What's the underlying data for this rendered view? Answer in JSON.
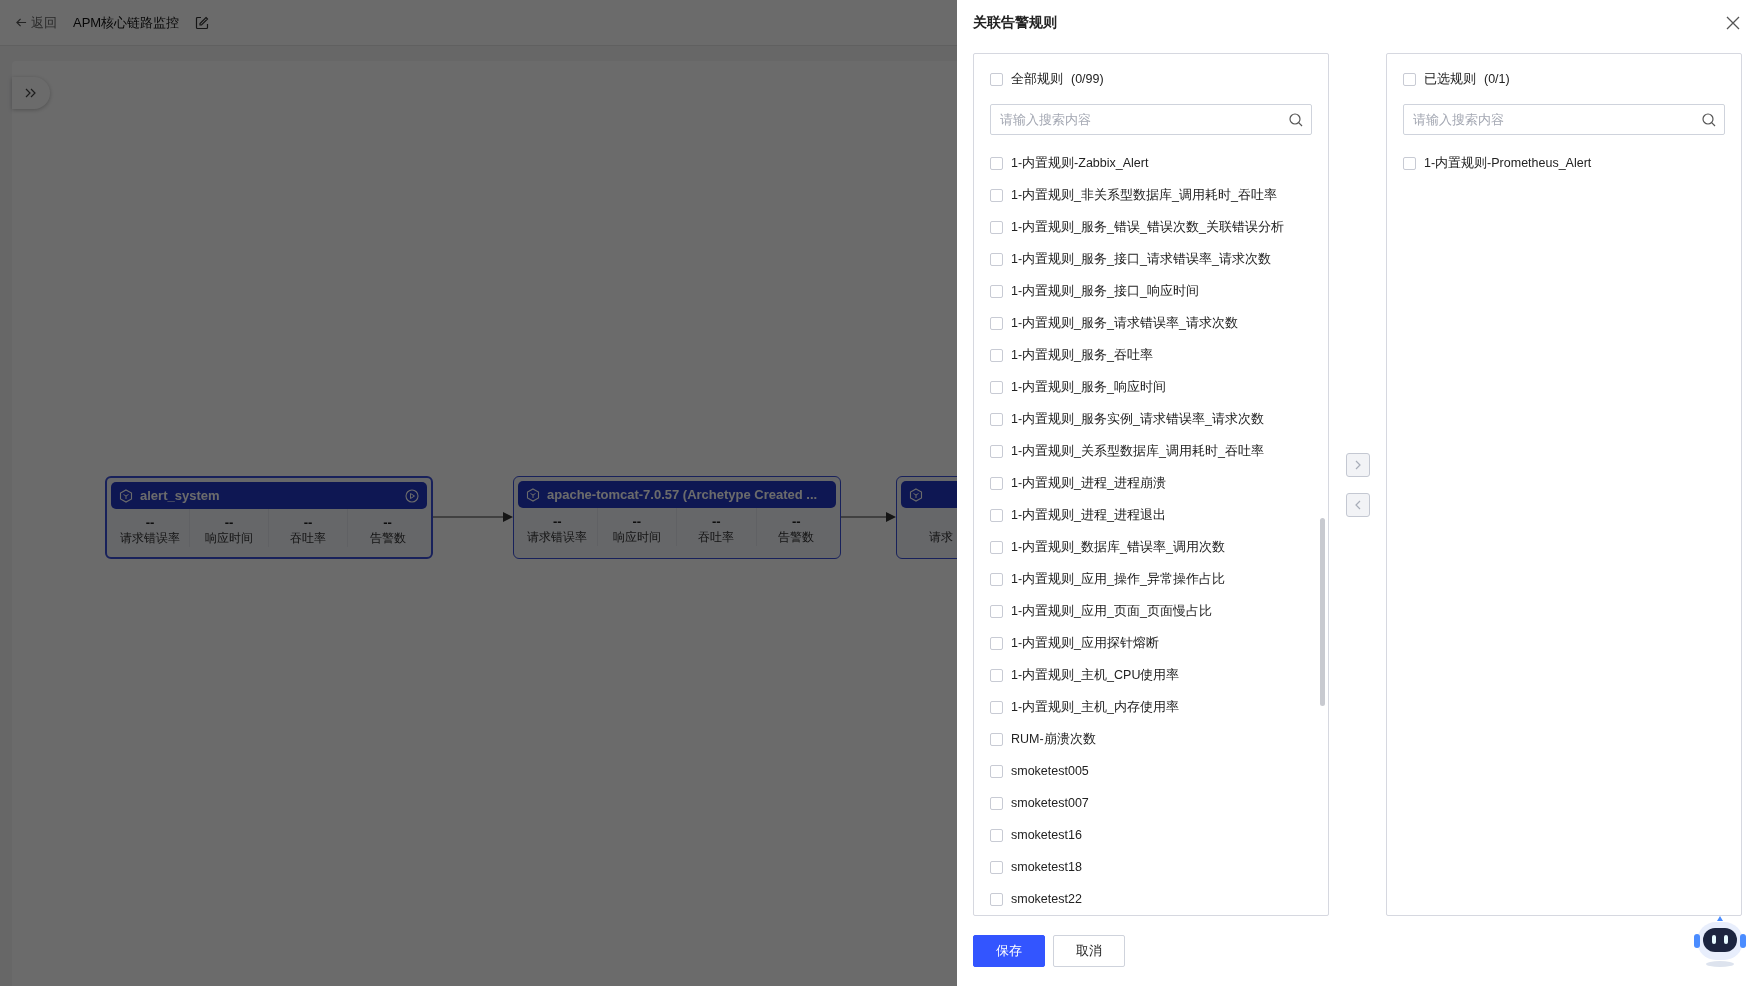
{
  "header": {
    "back": "返回",
    "title": "APM核心链路监控"
  },
  "nodes": [
    {
      "title": "alert_system",
      "action_icon": true,
      "metrics": [
        {
          "value": "--",
          "label": "请求错误率"
        },
        {
          "value": "--",
          "label": "响应时间"
        },
        {
          "value": "--",
          "label": "吞吐率"
        },
        {
          "value": "--",
          "label": "告警数"
        }
      ]
    },
    {
      "title": "apache-tomcat-7.0.57 (Archetype Created ...",
      "action_icon": false,
      "metrics": [
        {
          "value": "--",
          "label": "请求错误率"
        },
        {
          "value": "--",
          "label": "响应时间"
        },
        {
          "value": "--",
          "label": "吞吐率"
        },
        {
          "value": "--",
          "label": "告警数"
        }
      ]
    },
    {
      "metrics": [
        {
          "label": "请求"
        }
      ]
    }
  ],
  "drawer": {
    "title": "关联告警规则",
    "source": {
      "title": "全部规则",
      "count": "(0/99)",
      "checked": false,
      "placeholder": "请输入搜索内容",
      "items": [
        {
          "label": "1-内置规则-Zabbix_Alert",
          "checked": false
        },
        {
          "label": "1-内置规则_非关系型数据库_调用耗时_吞吐率",
          "checked": false
        },
        {
          "label": "1-内置规则_服务_错误_错误次数_关联错误分析",
          "checked": false
        },
        {
          "label": "1-内置规则_服务_接口_请求错误率_请求次数",
          "checked": false
        },
        {
          "label": "1-内置规则_服务_接口_响应时间",
          "checked": false
        },
        {
          "label": "1-内置规则_服务_请求错误率_请求次数",
          "checked": false
        },
        {
          "label": "1-内置规则_服务_吞吐率",
          "checked": false
        },
        {
          "label": "1-内置规则_服务_响应时间",
          "checked": false
        },
        {
          "label": "1-内置规则_服务实例_请求错误率_请求次数",
          "checked": false
        },
        {
          "label": "1-内置规则_关系型数据库_调用耗时_吞吐率",
          "checked": false
        },
        {
          "label": "1-内置规则_进程_进程崩溃",
          "checked": false
        },
        {
          "label": "1-内置规则_进程_进程退出",
          "checked": false
        },
        {
          "label": "1-内置规则_数据库_错误率_调用次数",
          "checked": false
        },
        {
          "label": "1-内置规则_应用_操作_异常操作占比",
          "checked": false
        },
        {
          "label": "1-内置规则_应用_页面_页面慢占比",
          "checked": false
        },
        {
          "label": "1-内置规则_应用探针熔断",
          "checked": false
        },
        {
          "label": "1-内置规则_主机_CPU使用率",
          "checked": false
        },
        {
          "label": "1-内置规则_主机_内存使用率",
          "checked": false
        },
        {
          "label": "RUM-崩溃次数",
          "checked": false
        },
        {
          "label": "smoketest005",
          "checked": false
        },
        {
          "label": "smoketest007",
          "checked": false
        },
        {
          "label": "smoketest16",
          "checked": false
        },
        {
          "label": "smoketest18",
          "checked": false
        },
        {
          "label": "smoketest22",
          "checked": false
        }
      ]
    },
    "target": {
      "title": "已选规则",
      "count": "(0/1)",
      "checked": false,
      "placeholder": "请输入搜索内容",
      "items": [
        {
          "label": "1-内置规则-Prometheus_Alert",
          "checked": false
        }
      ]
    },
    "move_right": {
      "disabled": true
    },
    "move_left": {
      "disabled": true
    },
    "buttons": [
      {
        "label": "保存",
        "kind": "primary"
      },
      {
        "label": "取消",
        "kind": "default"
      }
    ]
  }
}
